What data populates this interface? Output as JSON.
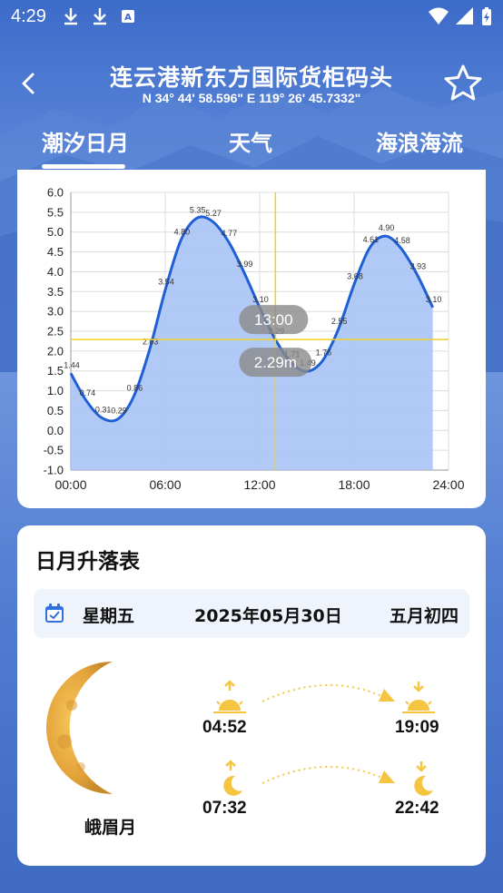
{
  "status_bar": {
    "time": "4:29",
    "icons": [
      "download-icon",
      "download-icon",
      "app-notification-icon"
    ],
    "right_icons": [
      "wifi-icon",
      "signal-icon",
      "battery-charging-icon"
    ]
  },
  "header": {
    "title": "连云港新东方国际货柜码头",
    "coordinates": "N 34° 44' 58.596\"  E 119° 26' 45.7332\""
  },
  "tabs": [
    {
      "label": "潮汐日月",
      "active": true
    },
    {
      "label": "天气",
      "active": false
    },
    {
      "label": "海浪海流",
      "active": false
    }
  ],
  "chart_data": {
    "type": "area",
    "xlim": [
      0,
      24
    ],
    "ylim": [
      -1.0,
      6.0
    ],
    "x_ticks": [
      "00:00",
      "06:00",
      "12:00",
      "18:00",
      "24:00"
    ],
    "y_ticks": [
      "6.0",
      "5.5",
      "5.0",
      "4.5",
      "4.0",
      "3.5",
      "3.0",
      "2.5",
      "2.0",
      "1.5",
      "1.0",
      "0.5",
      "0.0",
      "-0.5",
      "-1.0"
    ],
    "series": [
      {
        "x": [
          0,
          1,
          2,
          3,
          4,
          5,
          6,
          7,
          8,
          9,
          10,
          11,
          12,
          13,
          14,
          15,
          16,
          17,
          18,
          19,
          20,
          21,
          22,
          23
        ],
        "y": [
          1.44,
          0.74,
          0.31,
          0.29,
          0.86,
          2.03,
          3.54,
          4.8,
          5.35,
          5.27,
          4.77,
          3.99,
          3.1,
          2.29,
          1.71,
          1.49,
          1.76,
          2.55,
          3.68,
          4.61,
          4.9,
          4.58,
          3.93,
          3.1
        ],
        "labels": [
          "1.44",
          "0.74",
          "0.31",
          "0.29",
          "0.86",
          "2.03",
          "3.54",
          "4.80",
          "5.35",
          "5.27",
          "4.77",
          "3.99",
          "3.10",
          "2.29",
          "1.71",
          "1.49",
          "1.76",
          "2.55",
          "3.68",
          "4.61",
          "4.90",
          "4.58",
          "3.93",
          "3.10"
        ]
      }
    ],
    "crosshair": {
      "x": 13,
      "y": 2.29,
      "time_label": "13:00",
      "value_label": "2.29m"
    },
    "grid": true,
    "fill_color": "#a9c3f5",
    "line_color": "#1f5fd6",
    "crosshair_color": "#f2d024"
  },
  "sun_moon": {
    "title": "日月升落表",
    "weekday": "星期五",
    "date": "2025年05月30日",
    "lunar_date": "五月初四",
    "moon_phase": "峨眉月",
    "sunrise": "04:52",
    "sunset": "19:09",
    "moonrise": "07:32",
    "moonset": "22:42",
    "sun_color": "#f5c542",
    "accent_color": "#2f6fe0"
  }
}
